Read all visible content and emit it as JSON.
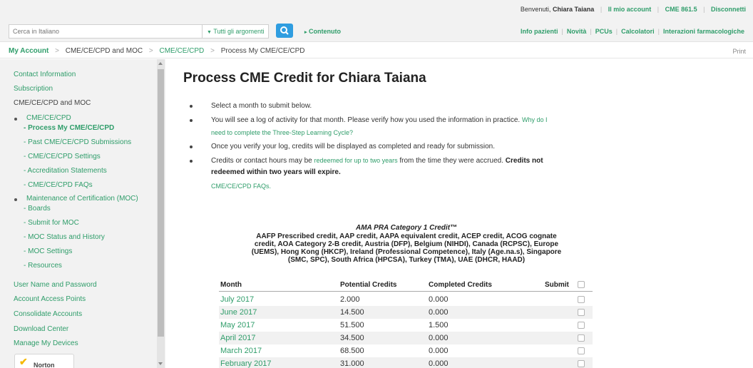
{
  "topbar": {
    "welcome_prefix": "Benvenuti,",
    "user_name": "Chiara Taiana",
    "links": [
      "Il mio account",
      "CME 861.5",
      "Disconnetti"
    ]
  },
  "search": {
    "placeholder": "Cerca in Italiano",
    "scope_label": "Tutti gli argomenti",
    "content_label": "Contenuto"
  },
  "main_nav": [
    "Info pazienti",
    "Novità",
    "PCUs",
    "Calcolatori",
    "Interazioni farmacologiche"
  ],
  "breadcrumb": [
    "My Account",
    "CME/CE/CPD and MOC",
    "CME/CE/CPD",
    "Process My CME/CE/CPD"
  ],
  "print_label": "Print",
  "sidebar": {
    "top_links": [
      "Contact Information",
      "Subscription"
    ],
    "section_title": "CME/CE/CPD and MOC",
    "group1_title": "CME/CE/CPD",
    "group1_items": [
      "- Process My CME/CE/CPD",
      "- Past CME/CE/CPD Submissions",
      "- CME/CE/CPD Settings",
      "- Accreditation Statements",
      "- CME/CE/CPD FAQs"
    ],
    "group2_title": "Maintenance of Certification (MOC)",
    "group2_items": [
      "- Boards",
      "- Submit for MOC",
      "- MOC Status and History",
      "- MOC Settings",
      "- Resources"
    ],
    "bottom_links": [
      "User Name and Password",
      "Account Access Points",
      "Consolidate Accounts",
      "Download Center",
      "Manage My Devices"
    ],
    "logo_text": "Norton"
  },
  "main": {
    "title": "Process CME Credit for Chiara Taiana",
    "bullets": {
      "b1": "Select a month to submit below.",
      "b2_text": "You will see a log of activity for that month. Please verify how you used the information in practice.",
      "b2_link_a": "Why do I",
      "b2_link_b": "need to complete the Three-Step Learning Cycle?",
      "b3": "Once you verify your log, credits will be displayed as completed and ready for submission.",
      "b4_pre": "Credits or contact hours may be",
      "b4_link": "redeemed for up to two years",
      "b4_post": "from the time they were accrued.",
      "b4_bold_a": "Credits not",
      "b4_bold_b": "redeemed within two years will expire."
    },
    "faq_link": "CME/CE/CPD FAQs.",
    "ama_title": "AMA PRA Category 1 Credit™",
    "ama_lines": [
      "AAFP Prescribed credit, AAP credit, AAPA equivalent credit, ACEP credit, ACOG cognate",
      "credit, AOA Category 2-B credit, Austria (DFP), Belgium (NIHDI), Canada (RCPSC), Europe",
      "(UEMS), Hong Kong (HKCP), Ireland (Professional Competence), Italy (Age.na.s), Singapore",
      "(SMC, SPC), South Africa (HPCSA), Turkey (TMA), UAE (DHCR, HAAD)"
    ]
  },
  "table": {
    "headers": [
      "Month",
      "Potential Credits",
      "Completed Credits",
      "Submit"
    ],
    "rows": [
      {
        "month": "July 2017",
        "potential": "2.000",
        "completed": "0.000"
      },
      {
        "month": "June 2017",
        "potential": "14.500",
        "completed": "0.000"
      },
      {
        "month": "May 2017",
        "potential": "51.500",
        "completed": "1.500"
      },
      {
        "month": "April 2017",
        "potential": "34.500",
        "completed": "0.000"
      },
      {
        "month": "March 2017",
        "potential": "68.500",
        "completed": "0.000"
      },
      {
        "month": "February 2017",
        "potential": "31.000",
        "completed": "0.000"
      }
    ]
  }
}
